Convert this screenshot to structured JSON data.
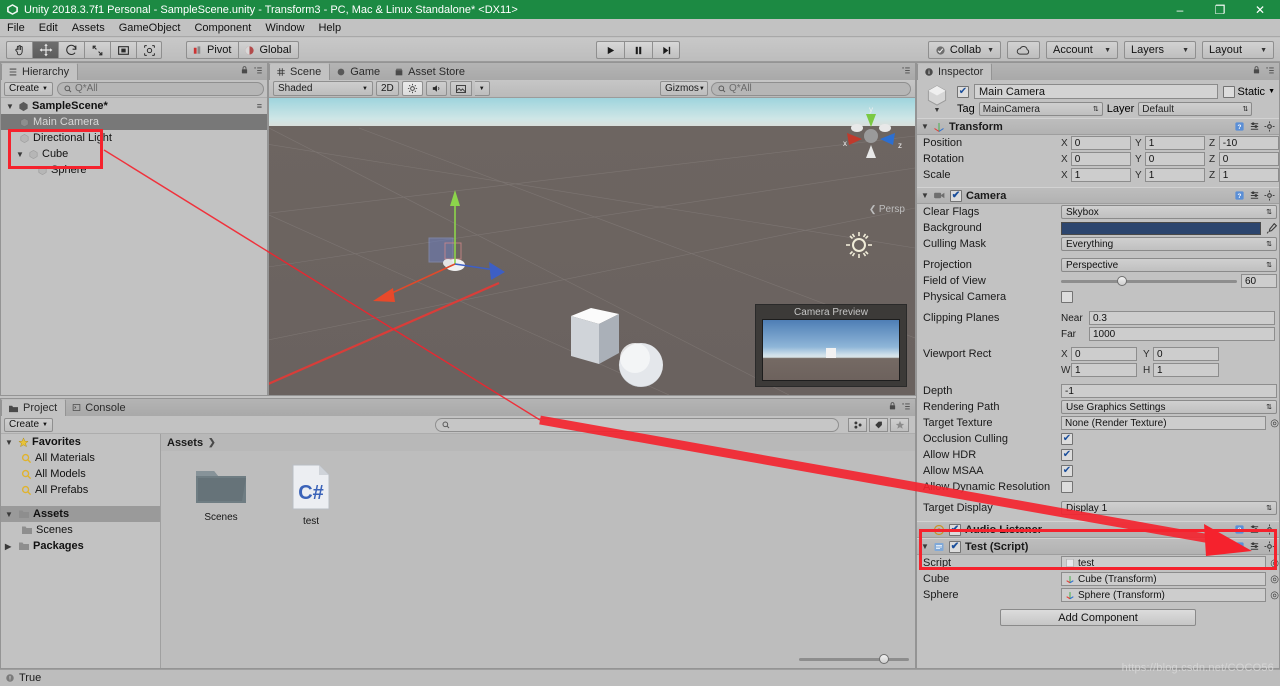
{
  "window": {
    "title": "Unity 2018.3.7f1 Personal - SampleScene.unity - Transform3 - PC, Mac & Linux Standalone* <DX11>",
    "app_icon": "unity-icon",
    "minimize": "–",
    "maximize": "❐",
    "close": "✕",
    "titlebar_color": "#1c8a43"
  },
  "menubar": {
    "items": [
      "File",
      "Edit",
      "Assets",
      "GameObject",
      "Component",
      "Window",
      "Help"
    ]
  },
  "toolbar": {
    "transform_tools": [
      {
        "name": "hand-tool",
        "active": false
      },
      {
        "name": "move-tool",
        "active": true
      },
      {
        "name": "rotate-tool",
        "active": false
      },
      {
        "name": "scale-tool",
        "active": false
      },
      {
        "name": "rect-tool",
        "active": false
      },
      {
        "name": "transform-tool",
        "active": false
      }
    ],
    "pivot_label": "Pivot",
    "global_label": "Global",
    "play_buttons": [
      "play-button",
      "pause-button",
      "step-button"
    ],
    "collab_label": "Collab",
    "cloud_label": "cloud-icon",
    "account_label": "Account",
    "layers_label": "Layers",
    "layout_label": "Layout"
  },
  "hierarchy": {
    "tab_label": "Hierarchy",
    "create_label": "Create",
    "search_placeholder": "Q*All",
    "scene_name": "SampleScene*",
    "items": [
      {
        "label": "Main Camera",
        "indent": 1,
        "selected": true,
        "twisty": ""
      },
      {
        "label": "Directional Light",
        "indent": 1,
        "selected": false,
        "twisty": ""
      },
      {
        "label": "Cube",
        "indent": 1,
        "selected": false,
        "twisty": "▼"
      },
      {
        "label": "Sphere",
        "indent": 2,
        "selected": false,
        "twisty": ""
      }
    ]
  },
  "sceneview": {
    "tabs": [
      {
        "label": "Scene",
        "icon": "grid-icon",
        "active": true
      },
      {
        "label": "Game",
        "icon": "gamepad-icon",
        "active": false
      },
      {
        "label": "Asset Store",
        "icon": "store-icon",
        "active": false
      }
    ],
    "shading_mode": "Shaded",
    "toggle_2d": "2D",
    "lighting_icon": "sun-toggle-icon",
    "audio_icon": "audio-toggle-icon",
    "effects_icon": "image-effects-icon",
    "gizmos_label": "Gizmos",
    "search_placeholder": "Q*All",
    "camera_preview_title": "Camera Preview",
    "axis_labels": {
      "x": "x",
      "y": "y",
      "z": "z"
    },
    "projection_label": "Persp"
  },
  "inspector": {
    "tab_label": "Inspector",
    "object_name": "Main Camera",
    "object_enabled": true,
    "static_label": "Static",
    "tag_label": "Tag",
    "tag_value": "MainCamera",
    "layer_label": "Layer",
    "layer_value": "Default",
    "transform": {
      "title": "Transform",
      "rows": [
        {
          "label": "Position",
          "x": "0",
          "y": "1",
          "z": "-10"
        },
        {
          "label": "Rotation",
          "x": "0",
          "y": "0",
          "z": "0"
        },
        {
          "label": "Scale",
          "x": "1",
          "y": "1",
          "z": "1"
        }
      ],
      "axis_x": "X",
      "axis_y": "Y",
      "axis_z": "Z"
    },
    "camera": {
      "title": "Camera",
      "enabled": true,
      "clear_flags_label": "Clear Flags",
      "clear_flags_value": "Skybox",
      "background_label": "Background",
      "background_color": "#2c456e",
      "culling_mask_label": "Culling Mask",
      "culling_mask_value": "Everything",
      "projection_label": "Projection",
      "projection_value": "Perspective",
      "fov_label": "Field of View",
      "fov_value": "60",
      "physical_camera_label": "Physical Camera",
      "physical_camera_checked": false,
      "clipping_label": "Clipping Planes",
      "near_label": "Near",
      "near_value": "0.3",
      "far_label": "Far",
      "far_value": "1000",
      "viewport_label": "Viewport Rect",
      "viewport_x_axis": "X",
      "viewport_x": "0",
      "viewport_y_axis": "Y",
      "viewport_y": "0",
      "viewport_w_axis": "W",
      "viewport_w": "1",
      "viewport_h_axis": "H",
      "viewport_h": "1",
      "depth_label": "Depth",
      "depth_value": "-1",
      "rendering_path_label": "Rendering Path",
      "rendering_path_value": "Use Graphics Settings",
      "target_texture_label": "Target Texture",
      "target_texture_value": "None (Render Texture)",
      "occlusion_label": "Occlusion Culling",
      "occlusion_checked": true,
      "hdr_label": "Allow HDR",
      "hdr_checked": true,
      "msaa_label": "Allow MSAA",
      "msaa_checked": true,
      "dynres_label": "Allow Dynamic Resolution",
      "dynres_checked": false,
      "target_display_label": "Target Display",
      "target_display_value": "Display 1"
    },
    "audio_listener": {
      "title": "Audio Listener",
      "enabled": true
    },
    "test_script": {
      "title": "Test (Script)",
      "enabled": true,
      "script_label": "Script",
      "script_value": "test",
      "fields": [
        {
          "label": "Cube",
          "value": "Cube (Transform)"
        },
        {
          "label": "Sphere",
          "value": "Sphere (Transform)"
        }
      ]
    },
    "add_component_label": "Add Component"
  },
  "project": {
    "tabs": [
      {
        "label": "Project",
        "icon": "folder-icon",
        "active": true
      },
      {
        "label": "Console",
        "icon": "console-icon",
        "active": false
      }
    ],
    "create_label": "Create",
    "search_placeholder": "",
    "tree": [
      {
        "label": "Favorites",
        "indent": 0,
        "twisty": "▼",
        "icon": "star-icon",
        "bold": true,
        "selected": false
      },
      {
        "label": "All Materials",
        "indent": 1,
        "twisty": "",
        "icon": "search-icon",
        "bold": false,
        "selected": false
      },
      {
        "label": "All Models",
        "indent": 1,
        "twisty": "",
        "icon": "search-icon",
        "bold": false,
        "selected": false
      },
      {
        "label": "All Prefabs",
        "indent": 1,
        "twisty": "",
        "icon": "search-icon",
        "bold": false,
        "selected": false
      },
      {
        "label": "Assets",
        "indent": 0,
        "twisty": "▼",
        "icon": "folder-icon",
        "bold": true,
        "selected": true
      },
      {
        "label": "Scenes",
        "indent": 1,
        "twisty": "",
        "icon": "folder-icon",
        "bold": false,
        "selected": false
      },
      {
        "label": "Packages",
        "indent": 0,
        "twisty": "▶",
        "icon": "folder-icon",
        "bold": true,
        "selected": false
      }
    ],
    "breadcrumb": "Assets",
    "breadcrumb_sep": "❯",
    "assets": [
      {
        "label": "Scenes",
        "type": "folder"
      },
      {
        "label": "test",
        "type": "csharp",
        "badge": "C#"
      }
    ]
  },
  "statusbar": {
    "icon": "console-log-icon",
    "message": "True",
    "watermark": "https://blog.csdn.net/COCO56"
  },
  "annotations": {
    "accent_color": "#f5222d",
    "boxes": [
      {
        "name": "hierarchy-cube-sphere-highlight"
      },
      {
        "name": "inspector-test-fields-highlight"
      }
    ],
    "arrow": {
      "name": "hierarchy-to-inspector-arrow"
    }
  }
}
